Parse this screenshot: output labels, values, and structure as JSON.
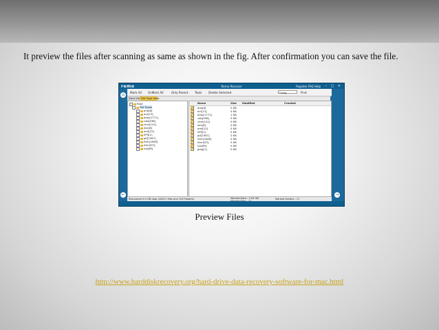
{
  "slide": {
    "body_text": "It preview the files after scanning as same as shown in the fig. After confirmation you can save the file.",
    "caption": "Preview Files",
    "link_text": "http://www.harddiskrecovery.org/hard-drive-data-recovery-software-for-mac.html",
    "colors": {
      "accent_link": "#c9a21a",
      "app_blue": "#0f5f8f"
    }
  },
  "app": {
    "logo": "remo",
    "title": "Remo Recover",
    "header_right": "Register   FAQ   Help",
    "window_controls": "– □ ×",
    "toolbar": {
      "mark_all": "Mark All",
      "unmark_all": "UnMark All",
      "only_parent": "Only Parent",
      "tools": "Tools",
      "delete": "Delete Selected",
      "search_value": "*.png",
      "find": "Find"
    },
    "tabs": {
      "data_view": "Data View",
      "file_type_view": "File Type View"
    },
    "tree": [
      "Root",
      "File Types",
      "arw[6]",
      "avi[13]",
      "bmp[1771]",
      "cab[498]",
      "chm[141]",
      "doc[8]",
      "emf[22]",
      "EPS[1]",
      "gif[2567]",
      "htm[1848]",
      "html[33]",
      "ico[89]"
    ],
    "columns": {
      "name": "Name",
      "size": "Size",
      "modified": "Modified",
      "created": "Created"
    },
    "files": [
      {
        "name": "arw[6]",
        "size": "0 KB"
      },
      {
        "name": "avi[13]",
        "size": "0 KB"
      },
      {
        "name": "bmp[1771]",
        "size": "1 KB"
      },
      {
        "name": "cab[498]",
        "size": "0 KB"
      },
      {
        "name": "chm[141]",
        "size": "0 KB"
      },
      {
        "name": "doc[8]",
        "size": "0 KB"
      },
      {
        "name": "emf[22]",
        "size": "0 KB"
      },
      {
        "name": "EPS[1]",
        "size": "0 KB"
      },
      {
        "name": "gif[2567]",
        "size": "2 KB"
      },
      {
        "name": "htm[1848]",
        "size": "0 KB"
      },
      {
        "name": "html[33]",
        "size": "0 KB"
      },
      {
        "name": "ico[89]",
        "size": "0 KB"
      },
      {
        "name": "jpeg[2]",
        "size": "0 KB"
      }
    ],
    "status": {
      "left": "Recovered 5.0 GB data (26417 files and 150 Folders)",
      "marked_data": "Marked Data : 2.09 GB",
      "marked_files": "Marked Files : 21",
      "marked_folders": "Marked Folders : 17"
    }
  }
}
